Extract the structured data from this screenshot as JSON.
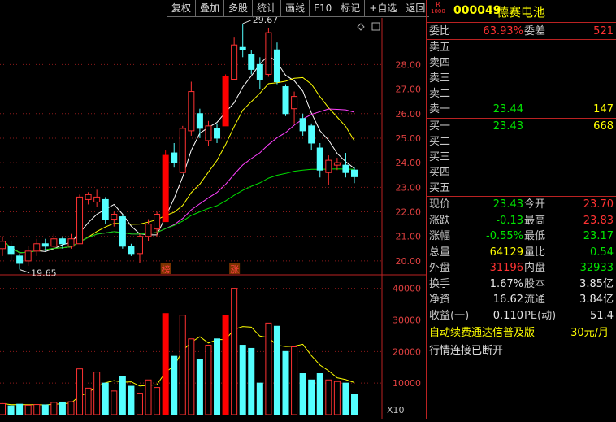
{
  "toolbar": {
    "buttons": [
      "复权",
      "叠加",
      "多股",
      "统计",
      "画线",
      "F10",
      "标记",
      "+自选",
      "返回"
    ]
  },
  "stock": {
    "badge_top": "R",
    "badge_bottom": "1000",
    "code": "000049",
    "name": "德赛电池"
  },
  "order_book": {
    "weibi_label": "委比",
    "weibi_value": "63.93%",
    "weicha_label": "委差",
    "weicha_value": "521",
    "asks": [
      {
        "label": "卖五",
        "price": "",
        "vol": ""
      },
      {
        "label": "卖四",
        "price": "",
        "vol": ""
      },
      {
        "label": "卖三",
        "price": "",
        "vol": ""
      },
      {
        "label": "卖二",
        "price": "",
        "vol": ""
      },
      {
        "label": "卖一",
        "price": "23.44",
        "vol": "147"
      }
    ],
    "bids": [
      {
        "label": "买一",
        "price": "23.43",
        "vol": "668"
      },
      {
        "label": "买二",
        "price": "",
        "vol": ""
      },
      {
        "label": "买三",
        "price": "",
        "vol": ""
      },
      {
        "label": "买四",
        "price": "",
        "vol": ""
      },
      {
        "label": "买五",
        "price": "",
        "vol": ""
      }
    ]
  },
  "stats": {
    "rows": [
      {
        "l1": "现价",
        "v1": "23.43",
        "c1": "green",
        "l2": "今开",
        "v2": "23.70",
        "c2": "red"
      },
      {
        "l1": "涨跌",
        "v1": "-0.13",
        "c1": "green",
        "l2": "最高",
        "v2": "23.83",
        "c2": "red"
      },
      {
        "l1": "涨幅",
        "v1": "-0.55%",
        "c1": "green",
        "l2": "最低",
        "v2": "23.17",
        "c2": "green"
      },
      {
        "l1": "总量",
        "v1": "64129",
        "c1": "yellow",
        "l2": "量比",
        "v2": "0.54",
        "c2": "green"
      },
      {
        "l1": "外盘",
        "v1": "31196",
        "c1": "red",
        "l2": "内盘",
        "v2": "32933",
        "c2": "green"
      }
    ],
    "rows2": [
      {
        "l1": "换手",
        "v1": "1.67%",
        "l2": "股本",
        "v2": "3.85亿"
      },
      {
        "l1": "净资",
        "v1": "16.62",
        "l2": "流通",
        "v2": "3.84亿"
      },
      {
        "l1": "收益(一)",
        "v1": "0.110",
        "l2": "PE(动)",
        "v2": "51.4"
      }
    ]
  },
  "promo": {
    "text": "自动续费通达信普及版",
    "price": "30元/月"
  },
  "status": {
    "text": "行情连接已断开"
  },
  "chart": {
    "price_ticks": [
      "28.00",
      "27.00",
      "26.00",
      "25.00",
      "24.00",
      "23.00",
      "22.00",
      "21.00",
      "20.00"
    ],
    "vol_ticks": [
      "40000",
      "30000",
      "20000",
      "10000"
    ],
    "vol_unit": "X10",
    "high_marker": "29.67",
    "low_marker": "19.65",
    "tag1": "榜",
    "tag2": "涨"
  },
  "chart_data": {
    "type": "candlestick",
    "price_range": [
      19.5,
      29.9
    ],
    "volume_range": [
      0,
      43000
    ],
    "candles": [
      {
        "o": 20.5,
        "c": 20.8,
        "h": 21.0,
        "l": 20.2,
        "v": 3500
      },
      {
        "o": 20.6,
        "c": 20.3,
        "h": 20.8,
        "l": 20.0,
        "v": 2800
      },
      {
        "o": 20.2,
        "c": 19.9,
        "h": 20.3,
        "l": 19.65,
        "v": 3300
      },
      {
        "o": 20.0,
        "c": 20.4,
        "h": 20.6,
        "l": 19.8,
        "v": 3000
      },
      {
        "o": 20.4,
        "c": 20.7,
        "h": 20.9,
        "l": 20.2,
        "v": 3200
      },
      {
        "o": 20.7,
        "c": 20.6,
        "h": 20.9,
        "l": 20.4,
        "v": 3100
      },
      {
        "o": 20.6,
        "c": 20.9,
        "h": 21.1,
        "l": 20.5,
        "v": 3900
      },
      {
        "o": 20.9,
        "c": 20.7,
        "h": 21.0,
        "l": 20.5,
        "v": 4000
      },
      {
        "o": 20.6,
        "c": 20.9,
        "h": 21.1,
        "l": 20.5,
        "v": 4100
      },
      {
        "o": 20.7,
        "c": 22.6,
        "h": 22.7,
        "l": 20.7,
        "v": 14500
      },
      {
        "o": 22.5,
        "c": 22.7,
        "h": 22.8,
        "l": 22.3,
        "v": 8400
      },
      {
        "o": 22.4,
        "c": 22.6,
        "h": 22.9,
        "l": 22.2,
        "v": 13500
      },
      {
        "o": 22.5,
        "c": 21.7,
        "h": 22.6,
        "l": 21.5,
        "v": 10000
      },
      {
        "o": 21.7,
        "c": 21.9,
        "h": 22.0,
        "l": 21.4,
        "v": 7500
      },
      {
        "o": 21.8,
        "c": 20.6,
        "h": 21.9,
        "l": 20.5,
        "v": 12000
      },
      {
        "o": 20.6,
        "c": 20.3,
        "h": 20.7,
        "l": 20.2,
        "v": 9000
      },
      {
        "o": 20.3,
        "c": 21.0,
        "h": 21.1,
        "l": 19.9,
        "v": 6800
      },
      {
        "o": 21.0,
        "c": 21.5,
        "h": 21.7,
        "l": 20.8,
        "v": 11000
      },
      {
        "o": 21.3,
        "c": 21.9,
        "h": 22.0,
        "l": 21.0,
        "v": 8600
      },
      {
        "o": 21.6,
        "c": 24.3,
        "h": 24.5,
        "l": 21.6,
        "v": 32000
      },
      {
        "o": 24.4,
        "c": 24.0,
        "h": 24.8,
        "l": 23.8,
        "v": 18500
      },
      {
        "o": 23.6,
        "c": 25.4,
        "h": 25.5,
        "l": 23.6,
        "v": 31500
      },
      {
        "o": 25.3,
        "c": 26.9,
        "h": 27.3,
        "l": 25.1,
        "v": 24000
      },
      {
        "o": 26.0,
        "c": 25.4,
        "h": 26.2,
        "l": 25.0,
        "v": 17500
      },
      {
        "o": 24.9,
        "c": 25.5,
        "h": 25.7,
        "l": 24.7,
        "v": 22000
      },
      {
        "o": 25.4,
        "c": 25.0,
        "h": 25.6,
        "l": 24.8,
        "v": 24000
      },
      {
        "o": 25.5,
        "c": 27.5,
        "h": 27.6,
        "l": 25.5,
        "v": 31500
      },
      {
        "o": 27.4,
        "c": 28.8,
        "h": 29.1,
        "l": 27.4,
        "v": 40000
      },
      {
        "o": 28.7,
        "c": 28.6,
        "h": 29.67,
        "l": 28.3,
        "v": 22000
      },
      {
        "o": 28.4,
        "c": 27.8,
        "h": 28.6,
        "l": 27.6,
        "v": 21000
      },
      {
        "o": 28.0,
        "c": 27.4,
        "h": 28.3,
        "l": 27.0,
        "v": 10000
      },
      {
        "o": 27.6,
        "c": 29.3,
        "h": 29.5,
        "l": 27.5,
        "v": 29000
      },
      {
        "o": 28.6,
        "c": 27.3,
        "h": 28.9,
        "l": 27.2,
        "v": 28000
      },
      {
        "o": 27.1,
        "c": 26.0,
        "h": 27.2,
        "l": 25.9,
        "v": 20000
      },
      {
        "o": 26.2,
        "c": 26.7,
        "h": 26.9,
        "l": 25.6,
        "v": 21500
      },
      {
        "o": 25.8,
        "c": 25.3,
        "h": 26.0,
        "l": 25.1,
        "v": 13000
      },
      {
        "o": 25.5,
        "c": 24.8,
        "h": 25.6,
        "l": 24.5,
        "v": 11000
      },
      {
        "o": 24.6,
        "c": 23.7,
        "h": 24.8,
        "l": 23.4,
        "v": 13000
      },
      {
        "o": 23.6,
        "c": 24.1,
        "h": 24.3,
        "l": 23.1,
        "v": 11000
      },
      {
        "o": 23.9,
        "c": 24.0,
        "h": 24.2,
        "l": 23.7,
        "v": 10500
      },
      {
        "o": 23.9,
        "c": 23.6,
        "h": 24.4,
        "l": 23.4,
        "v": 10000
      },
      {
        "o": 23.7,
        "c": 23.43,
        "h": 23.83,
        "l": 23.17,
        "v": 6400
      }
    ]
  },
  "colors": {
    "up": "#ff3232",
    "down": "#54ffff",
    "limit_up": "#ff0000",
    "grid": "#8b1a1a"
  }
}
